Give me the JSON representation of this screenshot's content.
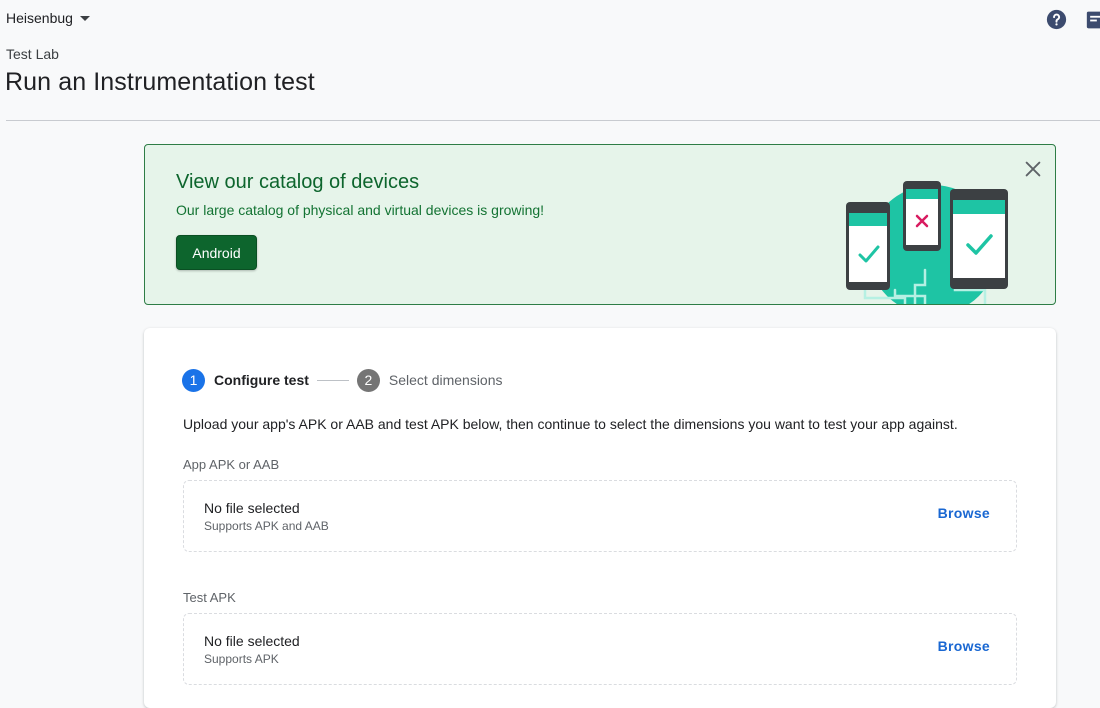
{
  "header": {
    "project_name": "Heisenbug",
    "project_dropdown_icon": "caret-down-icon",
    "help_icon": "help-icon",
    "feedback_icon": "feedback-icon"
  },
  "breadcrumb": "Test Lab",
  "page_title": "Run an Instrumentation test",
  "banner": {
    "title": "View our catalog of devices",
    "text": "Our large catalog of physical and virtual devices is growing!",
    "button_label": "Android",
    "close_icon": "close-icon",
    "illustration": "devices-illustration",
    "colors": {
      "background": "#e6f4ea",
      "border": "#2e7d46",
      "button": "#0d652d",
      "accent": "#1ec4a4"
    }
  },
  "stepper": {
    "steps": [
      {
        "number": "1",
        "label": "Configure test",
        "active": true
      },
      {
        "number": "2",
        "label": "Select dimensions",
        "active": false
      }
    ]
  },
  "instructions": "Upload your app's APK or AAB and test APK below, then continue to select the dimensions you want to test your app against.",
  "uploads": [
    {
      "label": "App APK or AAB",
      "status": "No file selected",
      "hint": "Supports APK and AAB",
      "action": "Browse"
    },
    {
      "label": "Test APK",
      "status": "No file selected",
      "hint": "Supports APK",
      "action": "Browse"
    }
  ],
  "colors": {
    "primary": "#1a73e8",
    "link": "#1967d2"
  }
}
